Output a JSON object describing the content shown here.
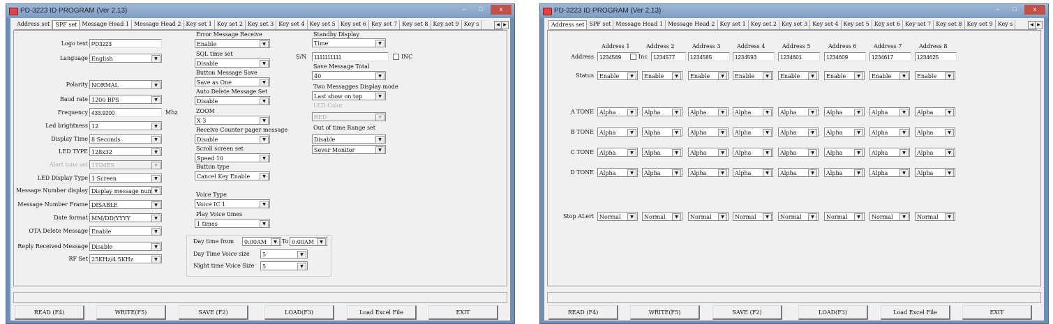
{
  "title": "PD-3223 ID PROGRAM (Ver 2.13)",
  "window_controls": {
    "minimize": "–",
    "maximize": "□",
    "close": "x"
  },
  "tabs": [
    "Address set",
    "SPF set",
    "Message Head 1",
    "Message Head 2",
    "Key set 1",
    "Key set 2",
    "Key set 3",
    "Key set 4",
    "Key set 5",
    "Key set 6",
    "Key set 7",
    "Key set 8",
    "Key set 9",
    "Key s"
  ],
  "tab_scroll": {
    "left": "◀",
    "right": "▶"
  },
  "buttons": [
    "READ (F4)",
    "WRITE(F5)",
    "SAVE (F2)",
    "LOAD(F3)",
    "Load Excel File",
    "EXIT"
  ],
  "spf": {
    "active_tab": "SPF set",
    "left_fields": [
      {
        "label": "Logo text",
        "value": "PD3223",
        "type": "text"
      },
      {
        "label": "Language",
        "value": "English",
        "type": "combo"
      },
      {
        "label": "Polarity",
        "value": "NORMAL",
        "type": "combo"
      },
      {
        "label": "Baud rate",
        "value": "1200 BPS",
        "type": "combo"
      },
      {
        "label": "Frequency",
        "value": "433.9200",
        "type": "text",
        "unit": "Mhz"
      },
      {
        "label": "Led brightness",
        "value": "12",
        "type": "combo"
      },
      {
        "label": "Display Time",
        "value": "8  Seconds",
        "type": "combo"
      },
      {
        "label": "LED TYPE",
        "value": "128x32",
        "type": "combo"
      },
      {
        "label": "Alert tone set",
        "value": "1TIMES",
        "type": "combo",
        "disabled": true
      },
      {
        "label": "LED Display Type",
        "value": "1 Screen",
        "type": "combo"
      },
      {
        "label": "Message Number display",
        "value": "Display message numbe",
        "type": "combo"
      },
      {
        "label": "Message Number Frame",
        "value": "DISABLE",
        "type": "combo"
      },
      {
        "label": "Date format",
        "value": "MM/DD/YYYY",
        "type": "combo"
      },
      {
        "label": "OTA Delete Message",
        "value": "Enable",
        "type": "combo"
      },
      {
        "label": "Reply Received Message",
        "value": "Disable",
        "type": "combo"
      },
      {
        "label": "RF Set",
        "value": "25KHz/4.5KHz",
        "type": "combo"
      }
    ],
    "middle_fields": [
      {
        "label": "Error Message Receive",
        "value": "Enable"
      },
      {
        "label": "SQL time  set",
        "value": "Disable"
      },
      {
        "label": "Button Message Save",
        "value": "Save as One"
      },
      {
        "label": "Auto Delete Message Set",
        "value": "Disable"
      },
      {
        "label": "ZOOM",
        "value": "X 3"
      },
      {
        "label": "Receive Counter pager message",
        "value": "Disable"
      },
      {
        "label": "Scroll screen set",
        "value": "Speed 10"
      },
      {
        "label": "Button type",
        "value": "Cancel Key Enable"
      },
      {
        "label": "Voice Type",
        "value": "Voice IC 1"
      },
      {
        "label": "Play Voice times",
        "value": "1 times"
      }
    ],
    "day_night": {
      "day_time_from_label": "Day time from",
      "day_time_from": "0:00AM",
      "to_label": "To",
      "day_time_to": "0:00AM",
      "day_voice_label": "Day Time Voice size",
      "day_voice": "5",
      "night_voice_label": "Night time Voice Size",
      "night_voice": "5"
    },
    "right": {
      "standby_label": "Standby Display",
      "standby": "Time",
      "sn_label": "S/N",
      "sn": "1111111111",
      "inc_label": "INC",
      "save_total_label": "Save Message Total",
      "save_total": "40",
      "two_msg_label": "Two Messagges Display mode",
      "two_msg": "Last show on top",
      "led_color_label": "LED Color",
      "led_color": "RED",
      "out_of_time_label": "Out of time Range set",
      "out_of_time": "Disable",
      "monitor": "Sever Monitor"
    }
  },
  "address": {
    "active_tab": "Address set",
    "headers": [
      "Address 1",
      "Address 2",
      "Address 3",
      "Address 4",
      "Address 5",
      "Address 6",
      "Address 7",
      "Address 8"
    ],
    "address_label": "Address",
    "inc_label": "Inc",
    "addresses": [
      "1234569",
      "1234577",
      "1234585",
      "1234593",
      "1234601",
      "1234609",
      "1234617",
      "1234625"
    ],
    "rows": [
      {
        "label": "Status",
        "values": [
          "Enable",
          "Enable",
          "Enable",
          "Enable",
          "Enable",
          "Enable",
          "Enable",
          "Enable"
        ]
      },
      {
        "label": "A TONE",
        "values": [
          "Alpha",
          "Alpha",
          "Alpha",
          "Alpha",
          "Alpha",
          "Alpha",
          "Alpha",
          "Alpha"
        ]
      },
      {
        "label": "B TONE",
        "values": [
          "Alpha",
          "Alpha",
          "Alpha",
          "Alpha",
          "Alpha",
          "Alpha",
          "Alpha",
          "Alpha"
        ]
      },
      {
        "label": "C TONE",
        "values": [
          "Alpha",
          "Alpha",
          "Alpha",
          "Alpha",
          "Alpha",
          "Alpha",
          "Alpha",
          "Alpha"
        ]
      },
      {
        "label": "D TONE",
        "values": [
          "Alpha",
          "Alpha",
          "Alpha",
          "Alpha",
          "Alpha",
          "Alpha",
          "Alpha",
          "Alpha"
        ]
      },
      {
        "label": "Stop ALert",
        "values": [
          "Normal",
          "Normal",
          "Normal",
          "Normal",
          "Normal",
          "Normal",
          "Normal",
          "Normal"
        ]
      }
    ]
  }
}
